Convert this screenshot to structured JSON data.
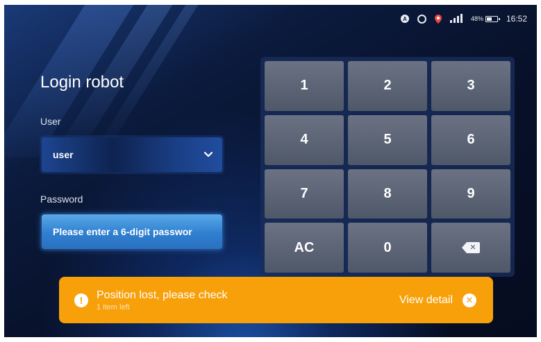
{
  "status_bar": {
    "nav_icon": "navigation-icon",
    "nav_glyph": "A",
    "alarm_icon": "alarm-icon",
    "location_icon": "location-icon",
    "signal_icon": "signal-icon",
    "battery_percent": "48%",
    "battery_level": 0.48,
    "time": "16:52"
  },
  "login": {
    "title": "Login robot",
    "user_label": "User",
    "user_value": "user",
    "password_label": "Password",
    "password_placeholder": "Please enter a 6-digit passwor"
  },
  "keypad": {
    "keys": [
      "1",
      "2",
      "3",
      "4",
      "5",
      "6",
      "7",
      "8",
      "9",
      "AC",
      "0"
    ],
    "backspace_icon": "backspace-icon"
  },
  "toast": {
    "title": "Position lost, please check",
    "subtitle": "1 item left",
    "action_label": "View detail",
    "icon": "alert-icon",
    "close_icon": "close-icon",
    "color": "#f7a00a"
  },
  "colors": {
    "background": "#08112a",
    "accent": "#2f7fd0",
    "key": "#5c6476",
    "toast": "#f7a00a"
  }
}
